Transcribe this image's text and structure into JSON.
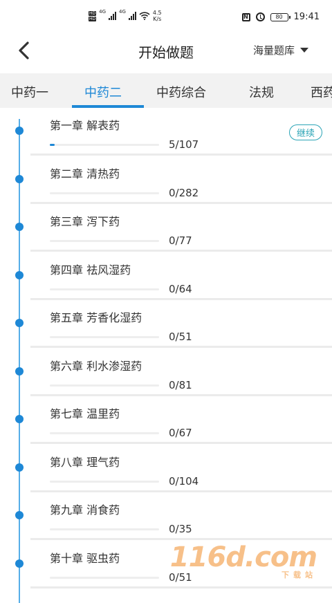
{
  "status_bar": {
    "hd_1": "HD",
    "hd_2": "HD",
    "net_1": "4G",
    "net_2": "4G",
    "speed_value": "4.5",
    "speed_unit": "K/s",
    "nfc": "N",
    "battery": "80",
    "time": "19:41"
  },
  "header": {
    "title": "开始做题",
    "bank_label": "海量题库"
  },
  "tabs": [
    {
      "label": "中药一",
      "active": false
    },
    {
      "label": "中药二",
      "active": true
    },
    {
      "label": "中药综合",
      "active": false
    },
    {
      "label": "法规",
      "active": false
    },
    {
      "label": "西药",
      "active": false
    }
  ],
  "continue_label": "继续",
  "chapters": [
    {
      "title": "第一章 解表药",
      "done": 5,
      "total": 107,
      "count": "5/107"
    },
    {
      "title": "第二章 清热药",
      "done": 0,
      "total": 282,
      "count": "0/282"
    },
    {
      "title": "第三章 泻下药",
      "done": 0,
      "total": 77,
      "count": "0/77"
    },
    {
      "title": "第四章 祛风湿药",
      "done": 0,
      "total": 64,
      "count": "0/64"
    },
    {
      "title": "第五章 芳香化湿药",
      "done": 0,
      "total": 51,
      "count": "0/51"
    },
    {
      "title": "第六章 利水渗湿药",
      "done": 0,
      "total": 81,
      "count": "0/81"
    },
    {
      "title": "第七章 温里药",
      "done": 0,
      "total": 67,
      "count": "0/67"
    },
    {
      "title": "第八章 理气药",
      "done": 0,
      "total": 104,
      "count": "0/104"
    },
    {
      "title": "第九章 消食药",
      "done": 0,
      "total": 35,
      "count": "0/35"
    },
    {
      "title": "第十章 驱虫药",
      "done": 0,
      "total": 51,
      "count": "0/51"
    }
  ],
  "watermark": {
    "main": "116d.com",
    "sub": "下载站"
  },
  "colors": {
    "accent": "#1e88d6",
    "continue": "#2ba4b6",
    "tab_bg": "#f2f2f2"
  }
}
